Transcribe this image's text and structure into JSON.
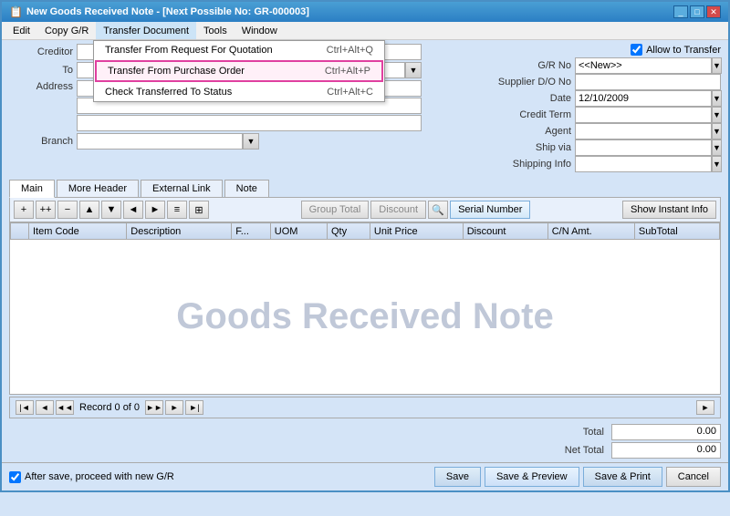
{
  "window": {
    "title": "New Goods Received Note - [Next Possible No: GR-000003]",
    "controls": [
      "minimize",
      "maximize",
      "close"
    ]
  },
  "menubar": {
    "items": [
      "Edit",
      "Copy G/R",
      "Transfer Document",
      "Tools",
      "Window"
    ]
  },
  "dropdown": {
    "parent": "Transfer Document",
    "items": [
      {
        "label": "Transfer From Request For Quotation",
        "shortcut": "Ctrl+Alt+Q",
        "highlighted": false
      },
      {
        "label": "Transfer From Purchase Order",
        "shortcut": "Ctrl+Alt+P",
        "highlighted": true
      },
      {
        "label": "Check Transferred To Status",
        "shortcut": "Ctrl+Alt+C",
        "highlighted": false
      }
    ]
  },
  "form": {
    "creditor_label": "Creditor",
    "to_label": "To",
    "address_label": "Address",
    "branch_label": "Branch",
    "allow_transfer_label": "Allow to Transfer",
    "gr_no_label": "G/R No",
    "gr_no_value": "<<New>>",
    "supplier_do_label": "Supplier D/O No",
    "date_label": "Date",
    "date_value": "12/10/2009",
    "credit_term_label": "Credit Term",
    "agent_label": "Agent",
    "ship_via_label": "Ship via",
    "shipping_info_label": "Shipping Info"
  },
  "tabs": {
    "items": [
      "Main",
      "More Header",
      "External Link",
      "Note"
    ]
  },
  "toolbar": {
    "buttons": [
      "+",
      "++",
      "-",
      "↑",
      "↓",
      "←",
      "→",
      "≡",
      "≡≡"
    ],
    "group_total_label": "Group Total",
    "discount_label": "Discount",
    "search_icon": "🔍",
    "serial_number_label": "Serial Number",
    "show_instant_info_label": "Show Instant Info"
  },
  "table": {
    "columns": [
      "Item Code",
      "Description",
      "F...",
      "UOM",
      "Qty",
      "Unit Price",
      "Discount",
      "C/N Amt.",
      "SubTotal"
    ]
  },
  "watermark": "Goods Received Note",
  "navigation": {
    "record_text": "Record 0 of 0"
  },
  "totals": {
    "total_label": "Total",
    "total_value": "0.00",
    "net_total_label": "Net Total",
    "net_total_value": "0.00"
  },
  "footer": {
    "checkbox_label": "After save, proceed with new G/R",
    "save_label": "Save",
    "save_preview_label": "Save & Preview",
    "save_print_label": "Save & Print",
    "cancel_label": "Cancel"
  }
}
